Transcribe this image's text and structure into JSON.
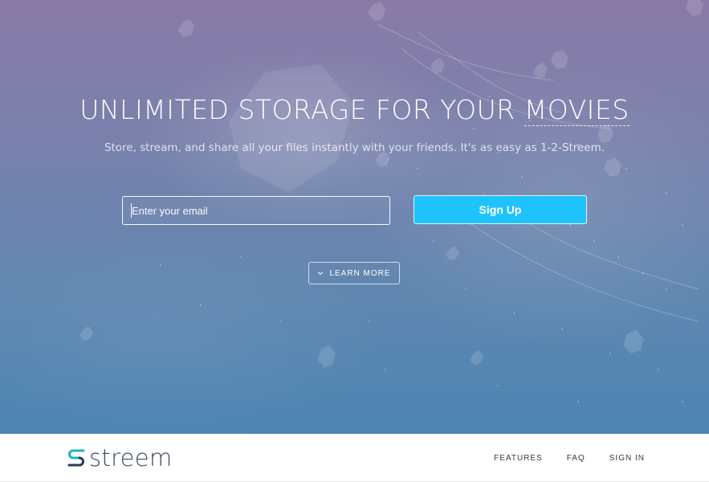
{
  "hero": {
    "title_main": "UNLIMITED STORAGE FOR YOUR ",
    "title_accent": "MOVIES",
    "subtitle": "Store, stream, and share all your files instantly with your friends. It's as easy as 1-2-Streem.",
    "email_placeholder": "Enter your email",
    "email_value": "",
    "signup_label": "Sign Up",
    "learn_more_label": "LEARN MORE",
    "learn_more_icon": "chevron-down-icon"
  },
  "navbar": {
    "logo_text": "streem",
    "logo_icon": "streem-logo-icon",
    "links": [
      {
        "label": "FEATURES"
      },
      {
        "label": "FAQ"
      },
      {
        "label": "SIGN IN"
      }
    ]
  },
  "colors": {
    "accent": "#1ec3fb",
    "hero_top": "#8a7aa8",
    "hero_bottom": "#4c85b3",
    "logo_teal": "#1fb6c4",
    "logo_navy": "#2a3b52",
    "nav_text": "#333c46"
  }
}
